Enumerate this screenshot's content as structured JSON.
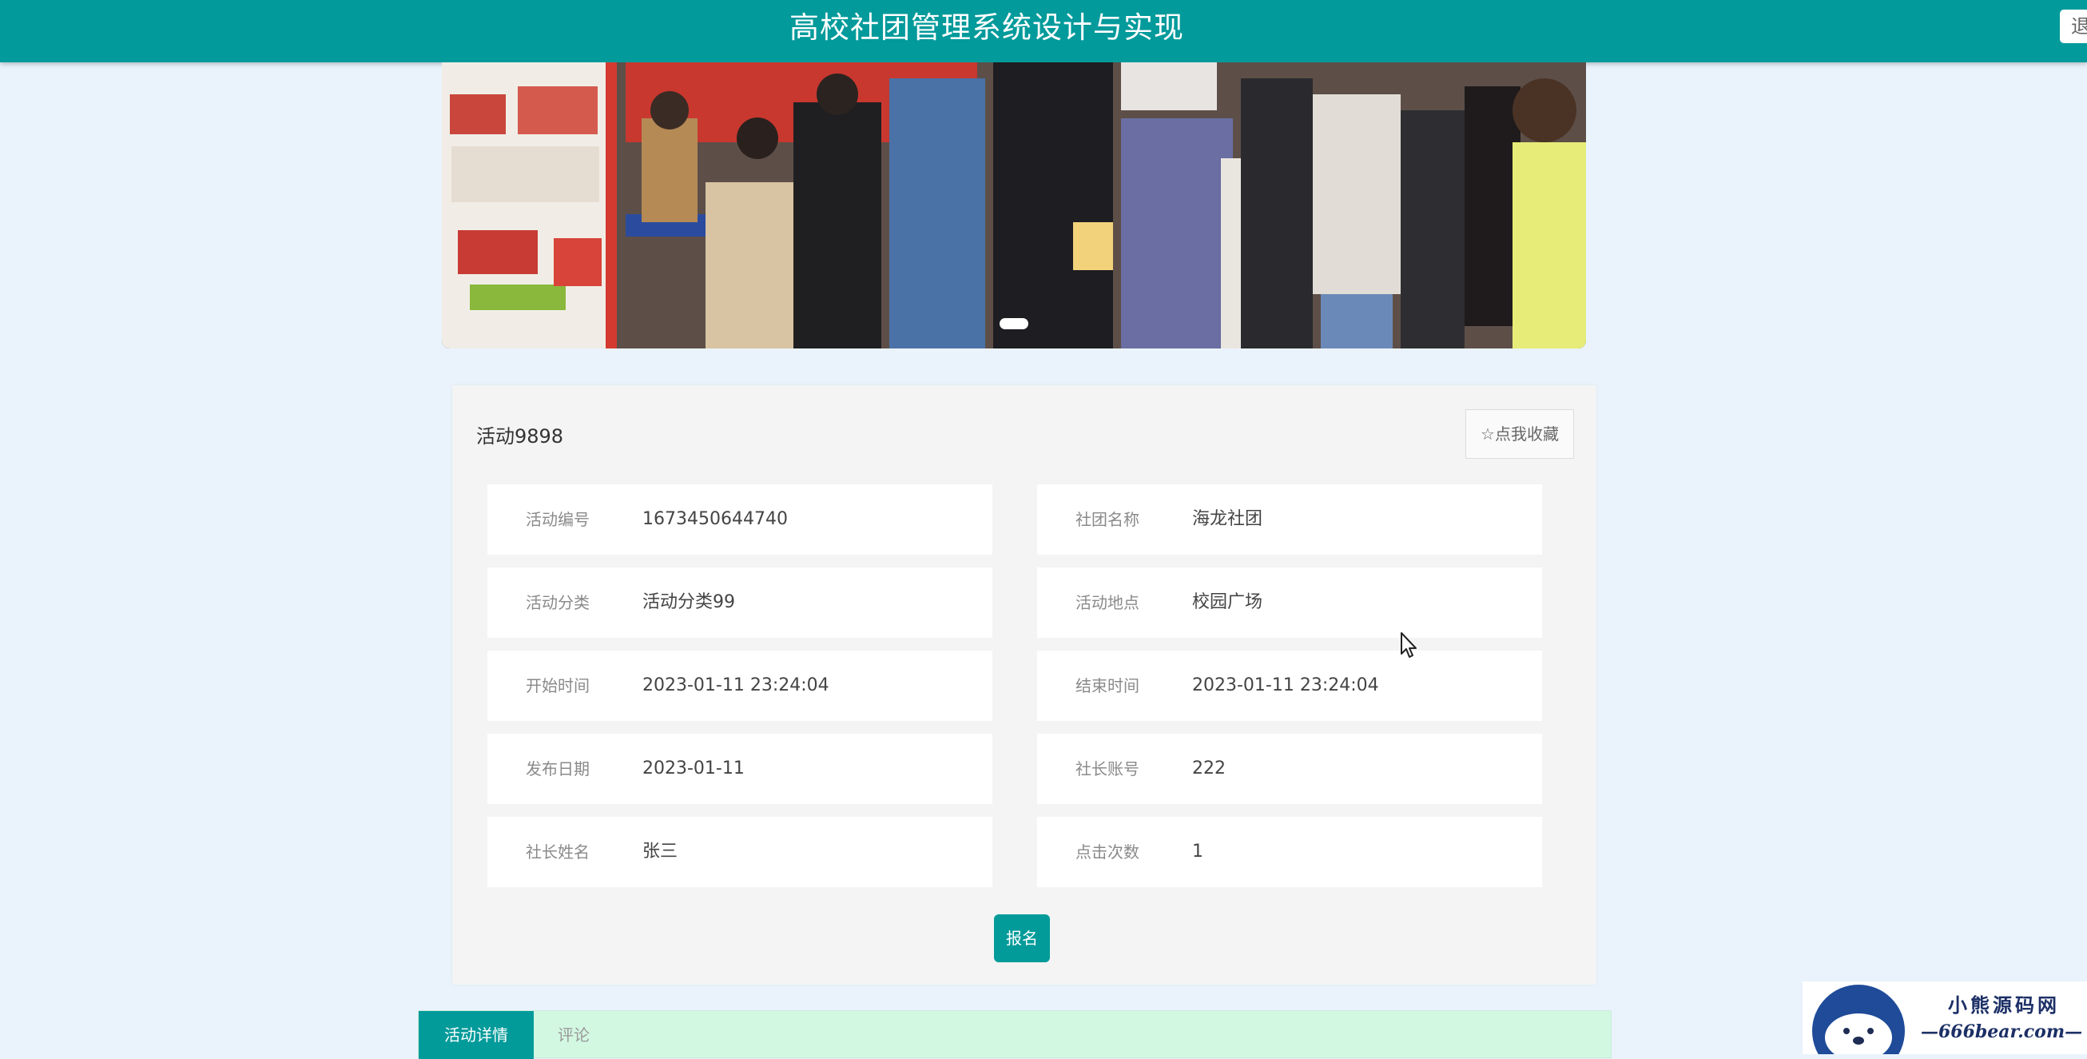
{
  "header": {
    "title": "高校社团管理系统设计与实现",
    "logout_label": "退出"
  },
  "banner": {
    "image_alt": "社团招新活动照片",
    "indicator_count": 1,
    "active_index": 0
  },
  "activity": {
    "name": "活动9898",
    "favorite_label": "☆点我收藏",
    "fields": [
      {
        "label": "活动编号",
        "value": "1673450644740"
      },
      {
        "label": "社团名称",
        "value": "海龙社团"
      },
      {
        "label": "活动分类",
        "value": "活动分类99"
      },
      {
        "label": "活动地点",
        "value": "校园广场"
      },
      {
        "label": "开始时间",
        "value": "2023-01-11 23:24:04"
      },
      {
        "label": "结束时间",
        "value": "2023-01-11 23:24:04"
      },
      {
        "label": "发布日期",
        "value": "2023-01-11"
      },
      {
        "label": "社长账号",
        "value": "222"
      },
      {
        "label": "社长姓名",
        "value": "张三"
      },
      {
        "label": "点击次数",
        "value": "1"
      }
    ],
    "signup_label": "报名"
  },
  "tabs": [
    {
      "label": "活动详情",
      "active": true
    },
    {
      "label": "评论",
      "active": false
    }
  ],
  "watermark": {
    "line1": "小熊源码网",
    "line2": "—666bear.com—"
  },
  "colors": {
    "primary": "#029a9b",
    "page_bg": "#eaf3fc",
    "tab_bar_bg": "#d3f8e2"
  }
}
